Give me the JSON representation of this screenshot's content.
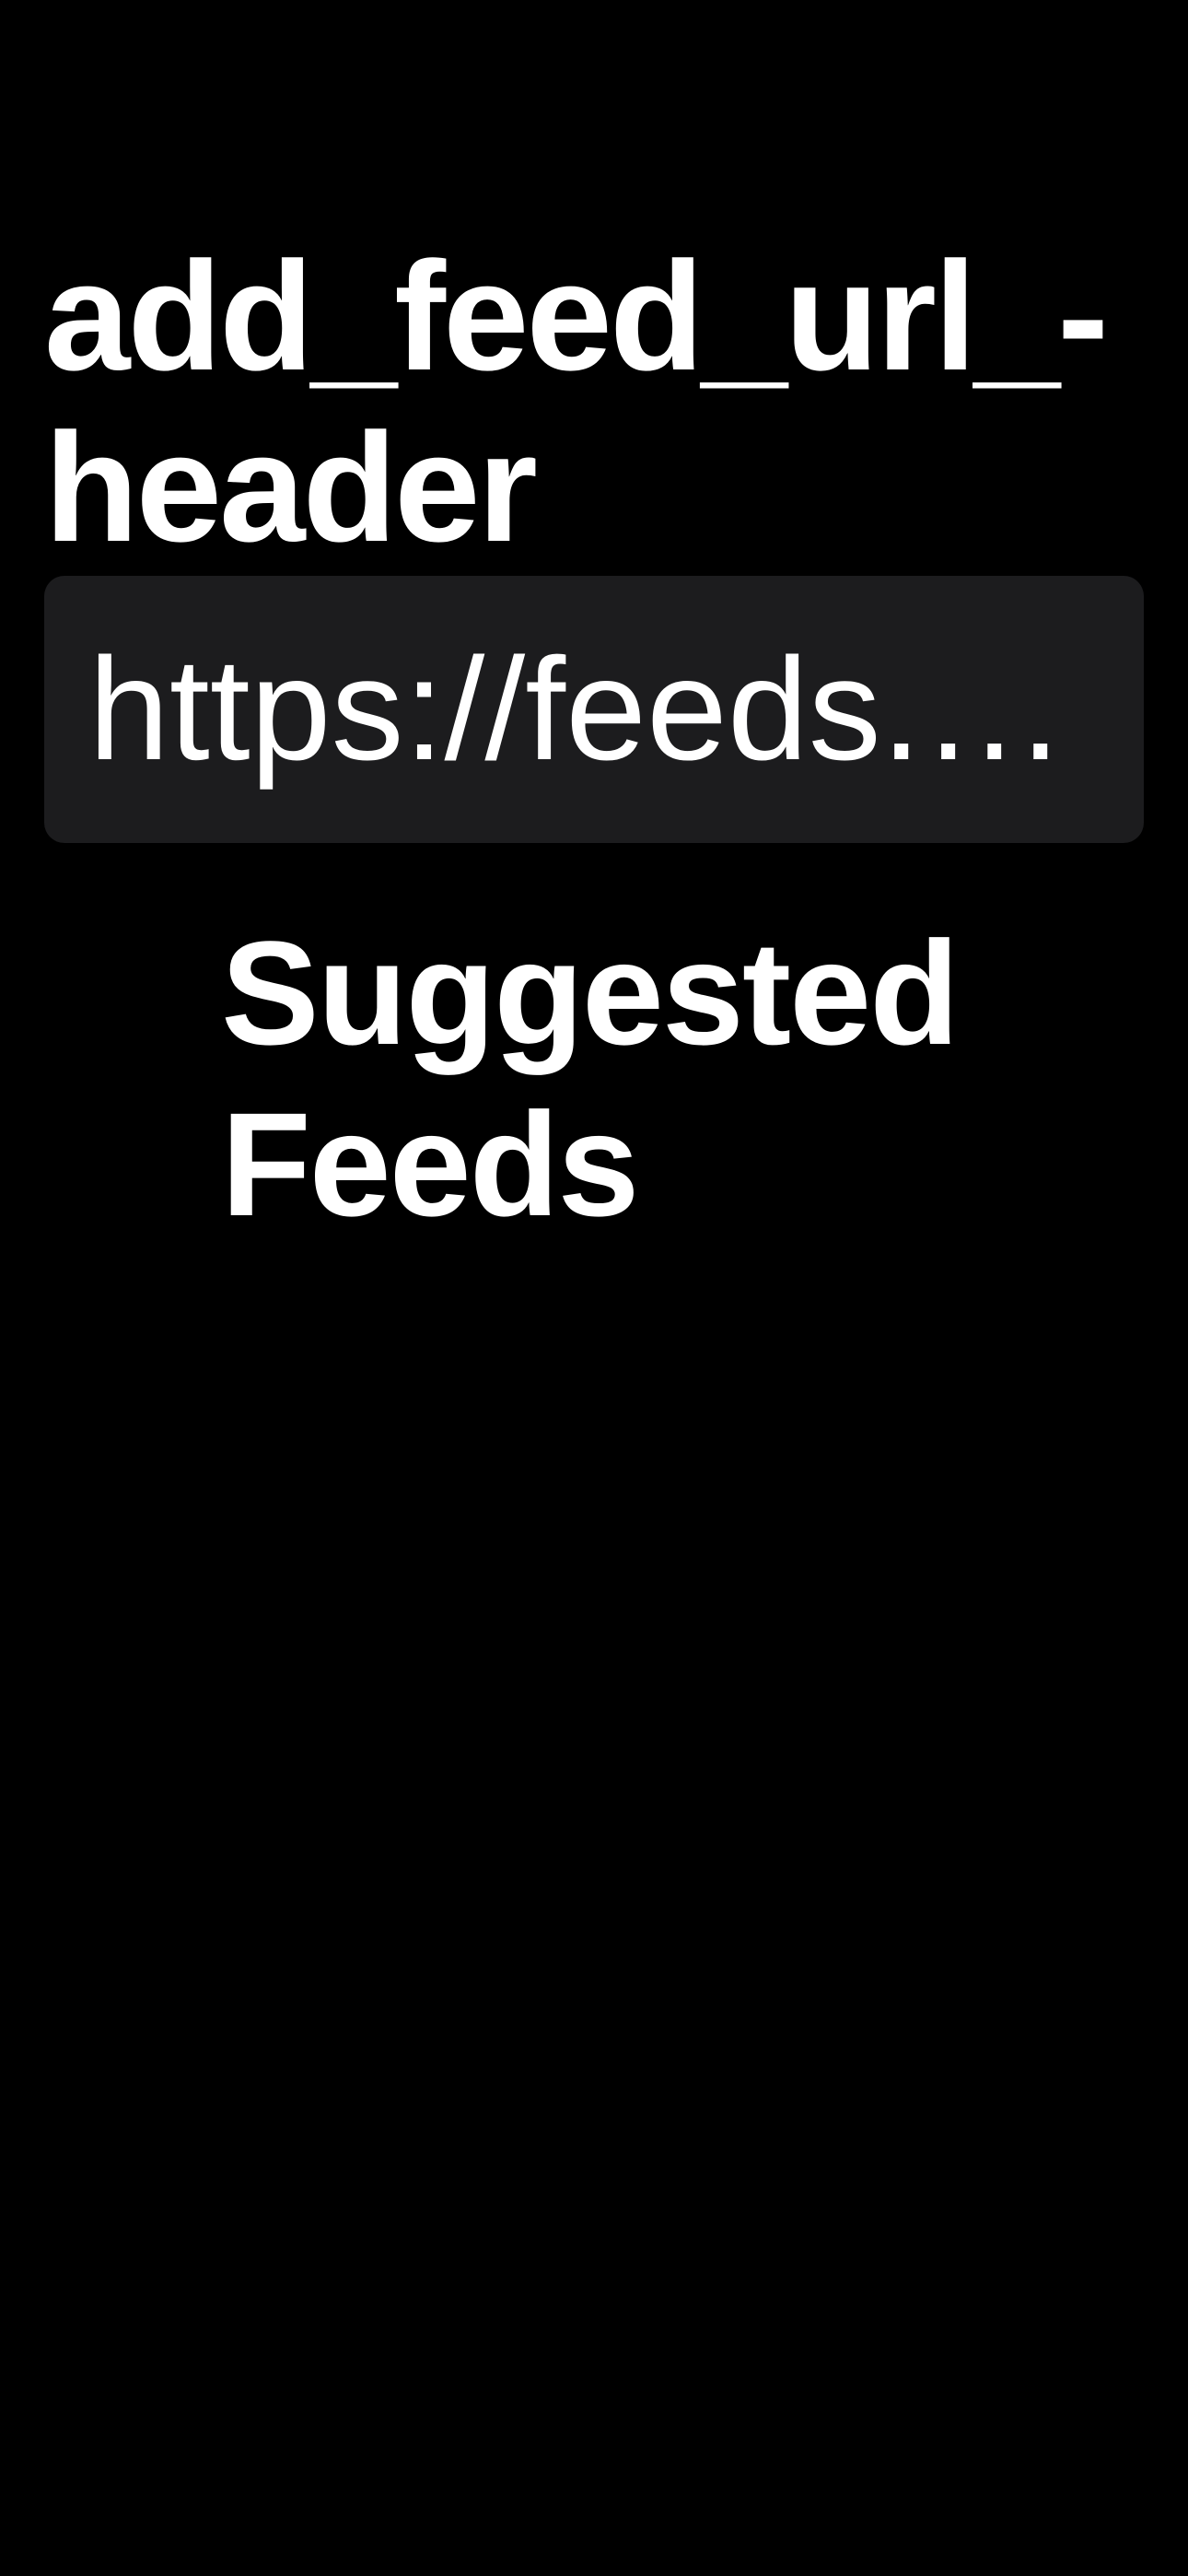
{
  "header": {
    "title": "add_feed_url_-header"
  },
  "url_field": {
    "value": "https://feeds.b…",
    "placeholder": ""
  },
  "suggested": {
    "heading": "Suggested Feeds"
  },
  "colors": {
    "background": "#000000",
    "field_background": "#1c1c1e",
    "text": "#ffffff"
  }
}
